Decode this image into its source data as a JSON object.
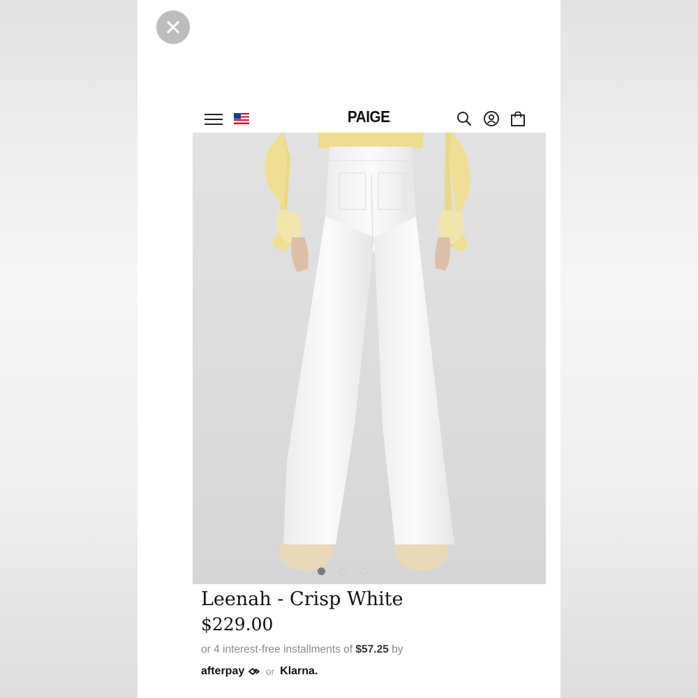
{
  "overlay": {
    "close_icon": "close-icon"
  },
  "header": {
    "menu_icon": "hamburger-menu-icon",
    "region_icon": "us-flag-icon",
    "logo": "PAIGE",
    "search_icon": "search-icon",
    "account_icon": "account-icon",
    "bag_icon": "shopping-bag-icon"
  },
  "gallery": {
    "total_slides": 3,
    "active_slide": 1
  },
  "product": {
    "title": "Leenah - Crisp White",
    "price": "$229.00",
    "installment_prefix": "or 4 interest-free installments of",
    "installment_amount": "$57.25",
    "installment_suffix": "by",
    "afterpay_label": "afterpay",
    "or_label": "or",
    "klarna_label": "Klarna."
  },
  "colors": {
    "background": "#fafafa",
    "close_button": "#bdbdbd",
    "text": "#111111",
    "muted": "#8a8a8a"
  }
}
